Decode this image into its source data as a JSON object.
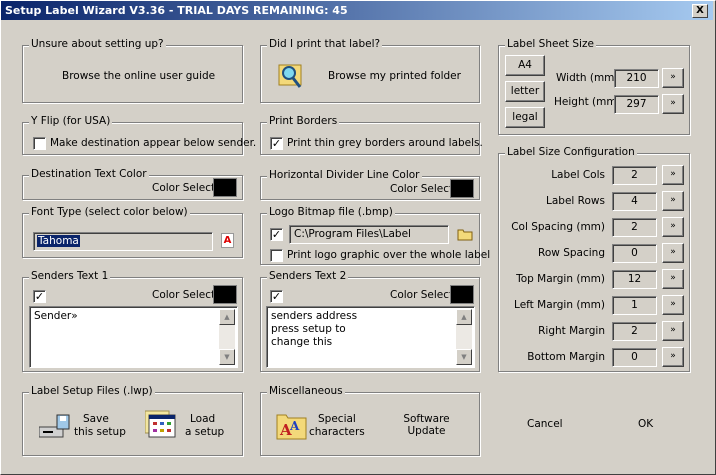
{
  "window": {
    "title": "Setup Label Wizard V3.36 - TRIAL DAYS REMAINING: 45",
    "close": "X"
  },
  "guide": {
    "legend": "Unsure about setting up?",
    "button": "Browse the online user guide"
  },
  "printed": {
    "legend": "Did I print that label?",
    "button": "Browse my printed folder"
  },
  "sheet": {
    "legend": "Label Sheet Size",
    "a4": "A4",
    "letter": "letter",
    "legal": "legal",
    "width_label": "Width (mm)",
    "width": "210",
    "height_label": "Height (mm)",
    "height": "297",
    "more": "»"
  },
  "yflip": {
    "legend": "Y Flip (for USA)",
    "checkbox": "Make destination appear below sender.",
    "checked": false
  },
  "borders": {
    "legend": "Print Borders",
    "checkbox": "Print thin grey borders around labels.",
    "checked": true
  },
  "dest_color": {
    "legend": "Destination Text Color",
    "label": "Color Select",
    "color": "#000000"
  },
  "divider_color": {
    "legend": "Horizontal Divider Line Color",
    "label": "Color Select",
    "color": "#000000"
  },
  "font": {
    "legend": "Font Type (select color below)",
    "value": "Tahoma"
  },
  "logo": {
    "legend": "Logo Bitmap file (.bmp)",
    "path": "C:\\Program Files\\Label Wizard\\",
    "checked": true,
    "whole_label": "Print logo graphic over the whole label",
    "whole_checked": false
  },
  "senders1": {
    "legend": "Senders Text 1",
    "label": "Color Select",
    "checked": true,
    "text": "Sender»"
  },
  "senders2": {
    "legend": "Senders Text 2",
    "label": "Color Select",
    "checked": true,
    "lines": [
      "senders address",
      "press setup to",
      "change this"
    ]
  },
  "files": {
    "legend": "Label Setup Files (.lwp)",
    "save1": "Save",
    "save2": "this setup",
    "load1": "Load",
    "load2": "a setup"
  },
  "misc": {
    "legend": "Miscellaneous",
    "special1": "Special",
    "special2": "characters",
    "update1": "Software",
    "update2": "Update"
  },
  "config": {
    "legend": "Label Size Configuration",
    "rows": [
      {
        "label": "Label Cols",
        "value": "2"
      },
      {
        "label": "Label Rows",
        "value": "4"
      },
      {
        "label": "Col Spacing (mm)",
        "value": "2"
      },
      {
        "label": "Row Spacing",
        "value": "0"
      },
      {
        "label": "Top Margin (mm)",
        "value": "12"
      },
      {
        "label": "Left Margin (mm)",
        "value": "1"
      },
      {
        "label": "Right Margin",
        "value": "2"
      },
      {
        "label": "Bottom Margin",
        "value": "0"
      }
    ]
  },
  "actions": {
    "cancel": "Cancel",
    "ok": "OK"
  }
}
